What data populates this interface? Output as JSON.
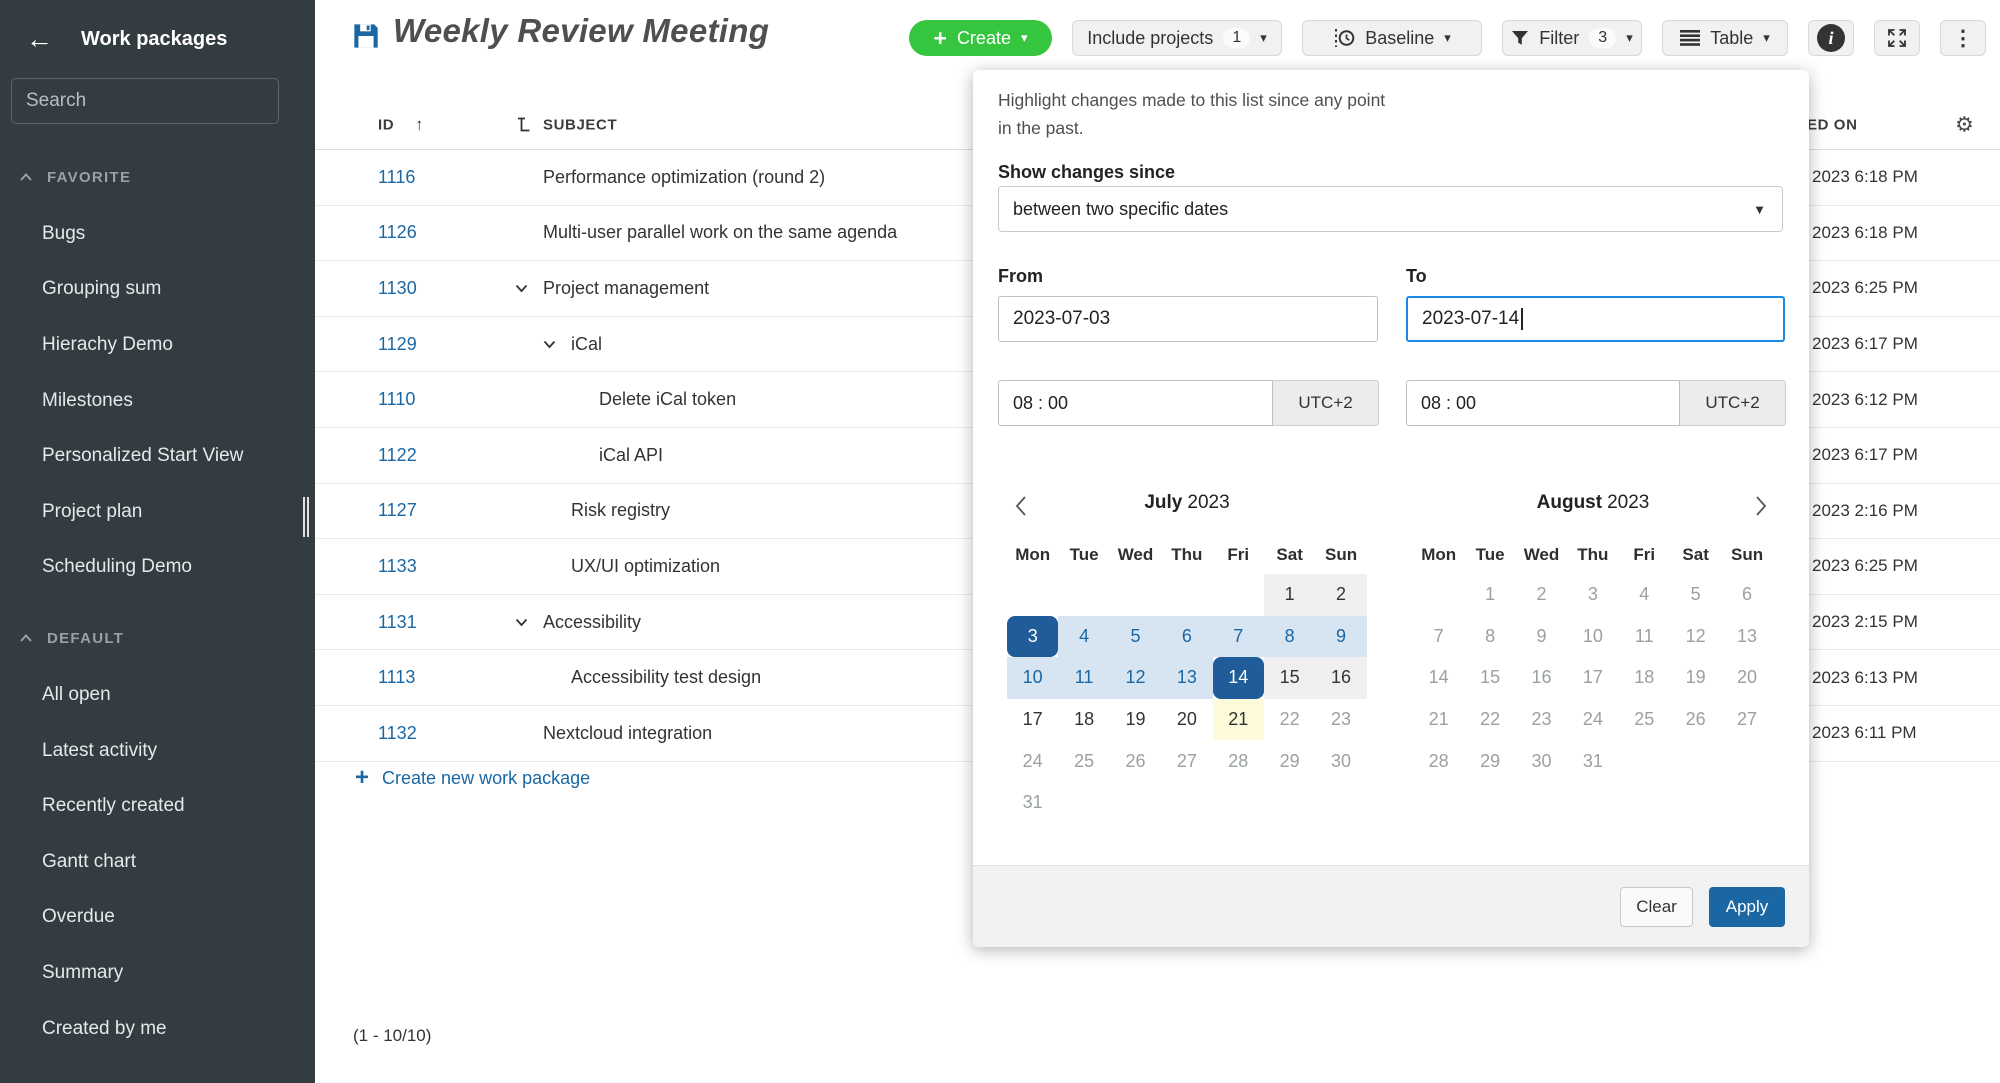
{
  "colors": {
    "accent_blue": "#1a67a3",
    "create_green": "#35c53f",
    "selected_day_bg": "#1f5c99",
    "range_bg": "#d7e5f3",
    "today_bg": "#fcfad9",
    "focus_border": "#1e88e5",
    "sidebar_bg": "#333c41"
  },
  "icons": {
    "back": "left-arrow",
    "search": "magnifier",
    "save": "floppy-disk",
    "create": "plus",
    "baseline": "dotted-line-clock",
    "filter": "funnel",
    "table": "horizontal-lines",
    "info": "i-in-circle",
    "fullscreen": "expand-arrows",
    "more": "kebab-dots",
    "sort": "arrow-up",
    "hierarchy": "tree-branch",
    "settings": "gear",
    "collapse": "chevron-up",
    "expand_row": "chevron-down",
    "cal_prev": "chevron-left",
    "cal_next": "chevron-right"
  },
  "sidebar": {
    "title": "Work packages",
    "search_placeholder": "Search",
    "sections": [
      {
        "label": "FAVORITE",
        "items": [
          "Bugs",
          "Grouping sum",
          "Hierachy Demo",
          "Milestones",
          "Personalized Start View",
          "Project plan",
          "Scheduling Demo"
        ]
      },
      {
        "label": "DEFAULT",
        "items": [
          "All open",
          "Latest activity",
          "Recently created",
          "Gantt chart",
          "Overdue",
          "Summary",
          "Created by me"
        ]
      }
    ]
  },
  "header": {
    "title": "Weekly Review Meeting",
    "create": "Create",
    "include_projects": "Include projects",
    "include_count": "1",
    "baseline": "Baseline",
    "filter": "Filter",
    "filter_count": "3",
    "table": "Table"
  },
  "table": {
    "col_id": "ID",
    "col_subject": "SUBJECT",
    "col_updated_clipped": "ED ON",
    "rows": [
      {
        "id": "1116",
        "subject": "Performance optimization (round 2)",
        "level": 0,
        "chevron": false,
        "updated": "2023 6:18 PM"
      },
      {
        "id": "1126",
        "subject": "Multi-user parallel work on the same agenda",
        "level": 0,
        "chevron": false,
        "updated": "2023 6:18 PM"
      },
      {
        "id": "1130",
        "subject": "Project management",
        "level": 0,
        "chevron": true,
        "updated": "2023 6:25 PM"
      },
      {
        "id": "1129",
        "subject": "iCal",
        "level": 1,
        "chevron": true,
        "updated": "2023 6:17 PM"
      },
      {
        "id": "1110",
        "subject": "Delete iCal token",
        "level": 2,
        "chevron": false,
        "updated": "2023 6:12 PM"
      },
      {
        "id": "1122",
        "subject": "iCal API",
        "level": 2,
        "chevron": false,
        "updated": "2023 6:17 PM"
      },
      {
        "id": "1127",
        "subject": "Risk registry",
        "level": 1,
        "chevron": false,
        "updated": "2023 2:16 PM"
      },
      {
        "id": "1133",
        "subject": "UX/UI optimization",
        "level": 1,
        "chevron": false,
        "updated": "2023 6:25 PM"
      },
      {
        "id": "1131",
        "subject": "Accessibility",
        "level": 0,
        "chevron": true,
        "updated": "2023 2:15 PM"
      },
      {
        "id": "1113",
        "subject": "Accessibility test design",
        "level": 1,
        "chevron": false,
        "updated": "2023 6:13 PM"
      },
      {
        "id": "1132",
        "subject": "Nextcloud integration",
        "level": 0,
        "chevron": false,
        "updated": "2023 6:11 PM"
      }
    ],
    "create_link": "Create new work package",
    "pagination": "(1 - 10/10)"
  },
  "panel": {
    "description": "Highlight changes made to this list since any point in the past.",
    "show_changes_since": "Show changes since",
    "mode_value": "between two specific dates",
    "from_label": "From",
    "to_label": "To",
    "from_date": "2023-07-03",
    "to_date": "2023-07-14",
    "from_time": "08 : 00",
    "to_time": "08 : 00",
    "utc_from": "UTC+2",
    "utc_to": "UTC+2",
    "clear": "Clear",
    "apply": "Apply",
    "calendars": [
      {
        "month": "July",
        "year": "2023",
        "weekdays": [
          "Mon",
          "Tue",
          "Wed",
          "Thu",
          "Fri",
          "Sat",
          "Sun"
        ],
        "weeks": [
          [
            {
              "d": "",
              "s": "empty"
            },
            {
              "d": "",
              "s": "empty"
            },
            {
              "d": "",
              "s": "empty"
            },
            {
              "d": "",
              "s": "empty"
            },
            {
              "d": "",
              "s": "empty"
            },
            {
              "d": "1",
              "s": "we"
            },
            {
              "d": "2",
              "s": "we"
            }
          ],
          [
            {
              "d": "3",
              "s": "sel"
            },
            {
              "d": "4",
              "s": "range"
            },
            {
              "d": "5",
              "s": "range"
            },
            {
              "d": "6",
              "s": "range"
            },
            {
              "d": "7",
              "s": "range"
            },
            {
              "d": "8",
              "s": "range"
            },
            {
              "d": "9",
              "s": "range"
            }
          ],
          [
            {
              "d": "10",
              "s": "range"
            },
            {
              "d": "11",
              "s": "range"
            },
            {
              "d": "12",
              "s": "range"
            },
            {
              "d": "13",
              "s": "range"
            },
            {
              "d": "14",
              "s": "sel"
            },
            {
              "d": "15",
              "s": "we"
            },
            {
              "d": "16",
              "s": "we"
            }
          ],
          [
            {
              "d": "17",
              "s": ""
            },
            {
              "d": "18",
              "s": ""
            },
            {
              "d": "19",
              "s": ""
            },
            {
              "d": "20",
              "s": ""
            },
            {
              "d": "21",
              "s": "today"
            },
            {
              "d": "22",
              "s": "dis"
            },
            {
              "d": "23",
              "s": "dis"
            }
          ],
          [
            {
              "d": "24",
              "s": "dis"
            },
            {
              "d": "25",
              "s": "dis"
            },
            {
              "d": "26",
              "s": "dis"
            },
            {
              "d": "27",
              "s": "dis"
            },
            {
              "d": "28",
              "s": "dis"
            },
            {
              "d": "29",
              "s": "dis"
            },
            {
              "d": "30",
              "s": "dis"
            }
          ],
          [
            {
              "d": "31",
              "s": "dis"
            },
            {
              "d": "",
              "s": "empty"
            },
            {
              "d": "",
              "s": "empty"
            },
            {
              "d": "",
              "s": "empty"
            },
            {
              "d": "",
              "s": "empty"
            },
            {
              "d": "",
              "s": "empty"
            },
            {
              "d": "",
              "s": "empty"
            }
          ]
        ]
      },
      {
        "month": "August",
        "year": "2023",
        "weekdays": [
          "Mon",
          "Tue",
          "Wed",
          "Thu",
          "Fri",
          "Sat",
          "Sun"
        ],
        "weeks": [
          [
            {
              "d": "",
              "s": "empty"
            },
            {
              "d": "1",
              "s": "dis"
            },
            {
              "d": "2",
              "s": "dis"
            },
            {
              "d": "3",
              "s": "dis"
            },
            {
              "d": "4",
              "s": "dis"
            },
            {
              "d": "5",
              "s": "dis"
            },
            {
              "d": "6",
              "s": "dis"
            }
          ],
          [
            {
              "d": "7",
              "s": "dis"
            },
            {
              "d": "8",
              "s": "dis"
            },
            {
              "d": "9",
              "s": "dis"
            },
            {
              "d": "10",
              "s": "dis"
            },
            {
              "d": "11",
              "s": "dis"
            },
            {
              "d": "12",
              "s": "dis"
            },
            {
              "d": "13",
              "s": "dis"
            }
          ],
          [
            {
              "d": "14",
              "s": "dis"
            },
            {
              "d": "15",
              "s": "dis"
            },
            {
              "d": "16",
              "s": "dis"
            },
            {
              "d": "17",
              "s": "dis"
            },
            {
              "d": "18",
              "s": "dis"
            },
            {
              "d": "19",
              "s": "dis"
            },
            {
              "d": "20",
              "s": "dis"
            }
          ],
          [
            {
              "d": "21",
              "s": "dis"
            },
            {
              "d": "22",
              "s": "dis"
            },
            {
              "d": "23",
              "s": "dis"
            },
            {
              "d": "24",
              "s": "dis"
            },
            {
              "d": "25",
              "s": "dis"
            },
            {
              "d": "26",
              "s": "dis"
            },
            {
              "d": "27",
              "s": "dis"
            }
          ],
          [
            {
              "d": "28",
              "s": "dis"
            },
            {
              "d": "29",
              "s": "dis"
            },
            {
              "d": "30",
              "s": "dis"
            },
            {
              "d": "31",
              "s": "dis"
            },
            {
              "d": "",
              "s": "empty"
            },
            {
              "d": "",
              "s": "empty"
            },
            {
              "d": "",
              "s": "empty"
            }
          ]
        ]
      }
    ]
  }
}
